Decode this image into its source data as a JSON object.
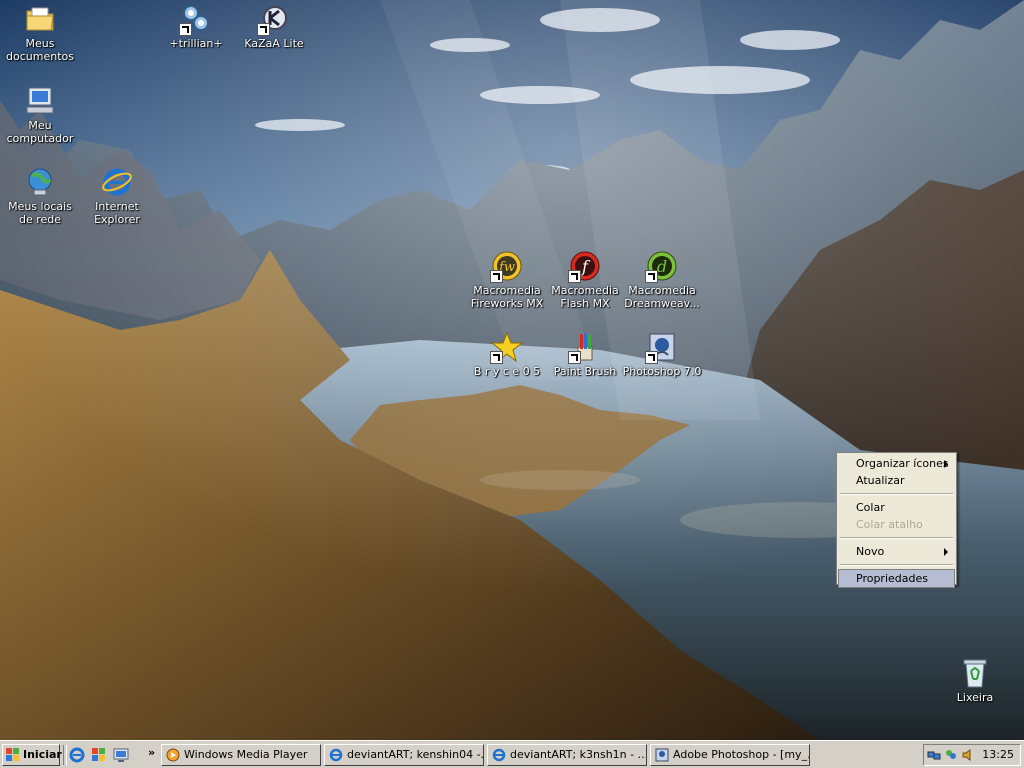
{
  "desktop": {
    "icons": [
      {
        "name": "my-documents",
        "label": "Meus documentos"
      },
      {
        "name": "trillian",
        "label": "+trillian+"
      },
      {
        "name": "kazaa-lite",
        "label": "KaZaA Lite"
      },
      {
        "name": "my-computer",
        "label": "Meu computador"
      },
      {
        "name": "network-places",
        "label": "Meus locais de rede"
      },
      {
        "name": "internet-explorer",
        "label": "Internet Explorer"
      },
      {
        "name": "fireworks",
        "label": "Macromedia Fireworks MX"
      },
      {
        "name": "flash",
        "label": "Macromedia Flash MX"
      },
      {
        "name": "dreamweaver",
        "label": "Macromedia Dreamweav..."
      },
      {
        "name": "bryce",
        "label": "B r y c e 0 5"
      },
      {
        "name": "paint-brush",
        "label": "Paint Brush"
      },
      {
        "name": "photoshop",
        "label": "Photoshop 7.0"
      },
      {
        "name": "recycle-bin",
        "label": "Lixeira"
      }
    ]
  },
  "context_menu": {
    "items": [
      {
        "label": "Organizar ícones",
        "submenu": true,
        "enabled": true
      },
      {
        "label": "Atualizar",
        "submenu": false,
        "enabled": true
      },
      {
        "label": "Colar",
        "submenu": false,
        "enabled": true
      },
      {
        "label": "Colar atalho",
        "submenu": false,
        "enabled": false
      },
      {
        "label": "Novo",
        "submenu": true,
        "enabled": true
      },
      {
        "label": "Propriedades",
        "submenu": false,
        "enabled": true,
        "highlighted": true
      }
    ]
  },
  "taskbar": {
    "start_label": "Iniciar",
    "quicklaunch_overflow": "»",
    "tasks": [
      {
        "label": "Windows Media Player",
        "icon": "media-player-icon"
      },
      {
        "label": "deviantART; kenshin04 -...",
        "icon": "ie-icon"
      },
      {
        "label": "deviantART; k3nsh1n - ...",
        "icon": "ie-icon"
      },
      {
        "label": "Adobe Photoshop - [my_...",
        "icon": "photoshop-icon"
      }
    ],
    "clock": "13:25"
  },
  "colors": {
    "taskbar": "#d4d0c8",
    "menu": "#ece9d8",
    "menu_highlight": "#b6bdd2"
  }
}
